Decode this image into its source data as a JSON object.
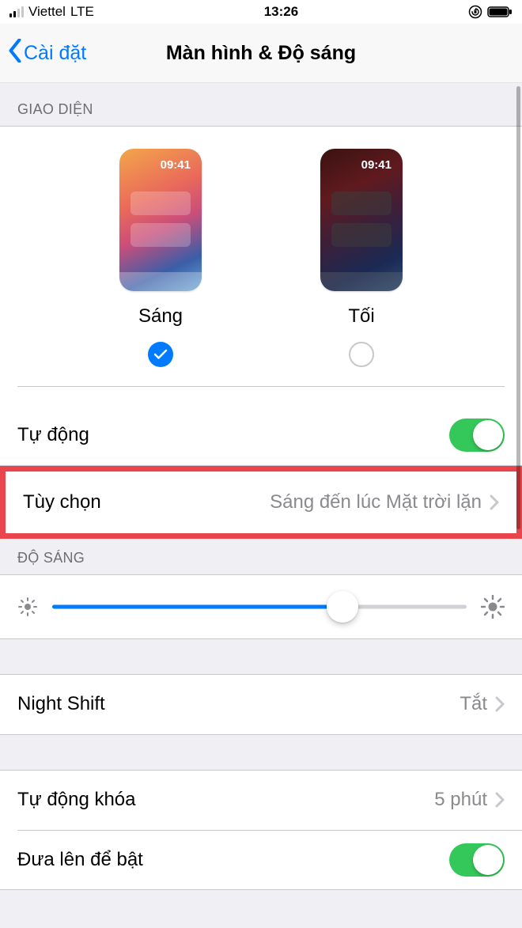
{
  "status": {
    "carrier": "Viettel",
    "network": "LTE",
    "time": "13:26"
  },
  "nav": {
    "back_label": "Cài đặt",
    "title": "Màn hình & Độ sáng"
  },
  "appearance": {
    "header": "GIAO DIỆN",
    "time_preview": "09:41",
    "light_label": "Sáng",
    "dark_label": "Tối",
    "selected": "light",
    "auto_label": "Tự động",
    "auto_on": true,
    "options_label": "Tùy chọn",
    "options_value": "Sáng đến lúc Mặt trời lặn"
  },
  "brightness": {
    "header": "ĐỘ SÁNG",
    "value_percent": 70
  },
  "night_shift": {
    "label": "Night Shift",
    "value": "Tắt"
  },
  "auto_lock": {
    "label": "Tự động khóa",
    "value": "5 phút"
  },
  "raise_to_wake": {
    "label": "Đưa lên để bật",
    "on": true
  }
}
